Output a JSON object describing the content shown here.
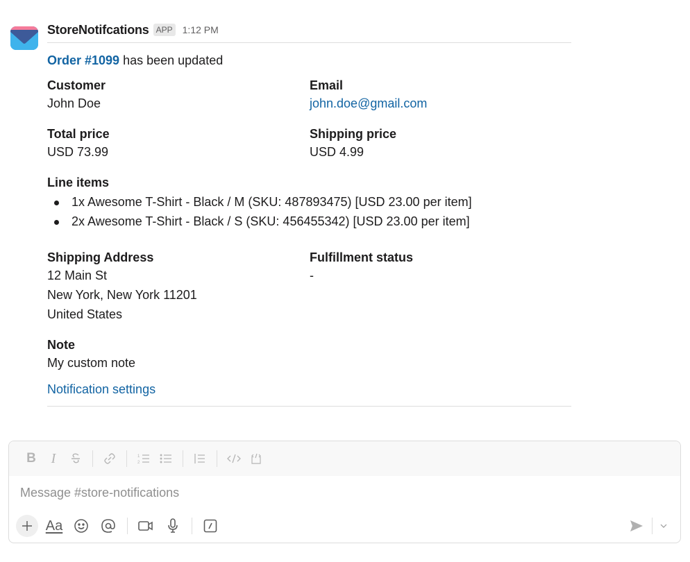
{
  "message": {
    "sender": "StoreNotifcations",
    "badge": "APP",
    "time": "1:12 PM",
    "title_link": "Order #1099",
    "title_rest": " has been updated",
    "fields_top": [
      {
        "label": "Customer",
        "value": "John Doe"
      },
      {
        "label": "Email",
        "value": "john.doe@gmail.com"
      },
      {
        "label": "Total price",
        "value": "USD 73.99"
      },
      {
        "label": "Shipping price",
        "value": "USD 4.99"
      }
    ],
    "line_items_label": "Line items",
    "line_items": [
      "1x Awesome T-Shirt - Black / M (SKU: 487893475) [USD 23.00 per item]",
      "2x Awesome T-Shirt - Black / S (SKU: 456455342) [USD 23.00 per item]"
    ],
    "shipping_address_label": "Shipping Address",
    "shipping_address": [
      "12 Main St",
      "New York, New York 11201",
      "United States"
    ],
    "fulfillment_label": "Fulfillment status",
    "fulfillment_value": "-",
    "note_label": "Note",
    "note_value": "My custom note",
    "settings_link": "Notification settings"
  },
  "composer": {
    "placeholder": "Message #store-notifications",
    "format_buttons": [
      "bold",
      "italic",
      "strikethrough",
      "link",
      "ordered-list",
      "bulleted-list",
      "blockquote",
      "code",
      "code-block"
    ],
    "bold_glyph": "B",
    "italic_glyph": "I",
    "text_format_glyph": "Aa"
  },
  "colors": {
    "link": "#1264a3",
    "text": "#1d1c1d",
    "muted": "#616061"
  }
}
